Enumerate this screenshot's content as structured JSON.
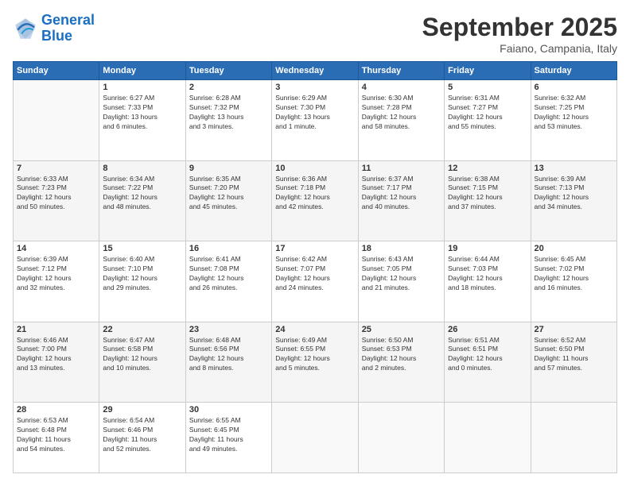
{
  "header": {
    "logo_general": "General",
    "logo_blue": "Blue",
    "month": "September 2025",
    "location": "Faiano, Campania, Italy"
  },
  "weekdays": [
    "Sunday",
    "Monday",
    "Tuesday",
    "Wednesday",
    "Thursday",
    "Friday",
    "Saturday"
  ],
  "weeks": [
    [
      {
        "day": "",
        "info": ""
      },
      {
        "day": "1",
        "info": "Sunrise: 6:27 AM\nSunset: 7:33 PM\nDaylight: 13 hours\nand 6 minutes."
      },
      {
        "day": "2",
        "info": "Sunrise: 6:28 AM\nSunset: 7:32 PM\nDaylight: 13 hours\nand 3 minutes."
      },
      {
        "day": "3",
        "info": "Sunrise: 6:29 AM\nSunset: 7:30 PM\nDaylight: 13 hours\nand 1 minute."
      },
      {
        "day": "4",
        "info": "Sunrise: 6:30 AM\nSunset: 7:28 PM\nDaylight: 12 hours\nand 58 minutes."
      },
      {
        "day": "5",
        "info": "Sunrise: 6:31 AM\nSunset: 7:27 PM\nDaylight: 12 hours\nand 55 minutes."
      },
      {
        "day": "6",
        "info": "Sunrise: 6:32 AM\nSunset: 7:25 PM\nDaylight: 12 hours\nand 53 minutes."
      }
    ],
    [
      {
        "day": "7",
        "info": "Sunrise: 6:33 AM\nSunset: 7:23 PM\nDaylight: 12 hours\nand 50 minutes."
      },
      {
        "day": "8",
        "info": "Sunrise: 6:34 AM\nSunset: 7:22 PM\nDaylight: 12 hours\nand 48 minutes."
      },
      {
        "day": "9",
        "info": "Sunrise: 6:35 AM\nSunset: 7:20 PM\nDaylight: 12 hours\nand 45 minutes."
      },
      {
        "day": "10",
        "info": "Sunrise: 6:36 AM\nSunset: 7:18 PM\nDaylight: 12 hours\nand 42 minutes."
      },
      {
        "day": "11",
        "info": "Sunrise: 6:37 AM\nSunset: 7:17 PM\nDaylight: 12 hours\nand 40 minutes."
      },
      {
        "day": "12",
        "info": "Sunrise: 6:38 AM\nSunset: 7:15 PM\nDaylight: 12 hours\nand 37 minutes."
      },
      {
        "day": "13",
        "info": "Sunrise: 6:39 AM\nSunset: 7:13 PM\nDaylight: 12 hours\nand 34 minutes."
      }
    ],
    [
      {
        "day": "14",
        "info": "Sunrise: 6:39 AM\nSunset: 7:12 PM\nDaylight: 12 hours\nand 32 minutes."
      },
      {
        "day": "15",
        "info": "Sunrise: 6:40 AM\nSunset: 7:10 PM\nDaylight: 12 hours\nand 29 minutes."
      },
      {
        "day": "16",
        "info": "Sunrise: 6:41 AM\nSunset: 7:08 PM\nDaylight: 12 hours\nand 26 minutes."
      },
      {
        "day": "17",
        "info": "Sunrise: 6:42 AM\nSunset: 7:07 PM\nDaylight: 12 hours\nand 24 minutes."
      },
      {
        "day": "18",
        "info": "Sunrise: 6:43 AM\nSunset: 7:05 PM\nDaylight: 12 hours\nand 21 minutes."
      },
      {
        "day": "19",
        "info": "Sunrise: 6:44 AM\nSunset: 7:03 PM\nDaylight: 12 hours\nand 18 minutes."
      },
      {
        "day": "20",
        "info": "Sunrise: 6:45 AM\nSunset: 7:02 PM\nDaylight: 12 hours\nand 16 minutes."
      }
    ],
    [
      {
        "day": "21",
        "info": "Sunrise: 6:46 AM\nSunset: 7:00 PM\nDaylight: 12 hours\nand 13 minutes."
      },
      {
        "day": "22",
        "info": "Sunrise: 6:47 AM\nSunset: 6:58 PM\nDaylight: 12 hours\nand 10 minutes."
      },
      {
        "day": "23",
        "info": "Sunrise: 6:48 AM\nSunset: 6:56 PM\nDaylight: 12 hours\nand 8 minutes."
      },
      {
        "day": "24",
        "info": "Sunrise: 6:49 AM\nSunset: 6:55 PM\nDaylight: 12 hours\nand 5 minutes."
      },
      {
        "day": "25",
        "info": "Sunrise: 6:50 AM\nSunset: 6:53 PM\nDaylight: 12 hours\nand 2 minutes."
      },
      {
        "day": "26",
        "info": "Sunrise: 6:51 AM\nSunset: 6:51 PM\nDaylight: 12 hours\nand 0 minutes."
      },
      {
        "day": "27",
        "info": "Sunrise: 6:52 AM\nSunset: 6:50 PM\nDaylight: 11 hours\nand 57 minutes."
      }
    ],
    [
      {
        "day": "28",
        "info": "Sunrise: 6:53 AM\nSunset: 6:48 PM\nDaylight: 11 hours\nand 54 minutes."
      },
      {
        "day": "29",
        "info": "Sunrise: 6:54 AM\nSunset: 6:46 PM\nDaylight: 11 hours\nand 52 minutes."
      },
      {
        "day": "30",
        "info": "Sunrise: 6:55 AM\nSunset: 6:45 PM\nDaylight: 11 hours\nand 49 minutes."
      },
      {
        "day": "",
        "info": ""
      },
      {
        "day": "",
        "info": ""
      },
      {
        "day": "",
        "info": ""
      },
      {
        "day": "",
        "info": ""
      }
    ]
  ]
}
